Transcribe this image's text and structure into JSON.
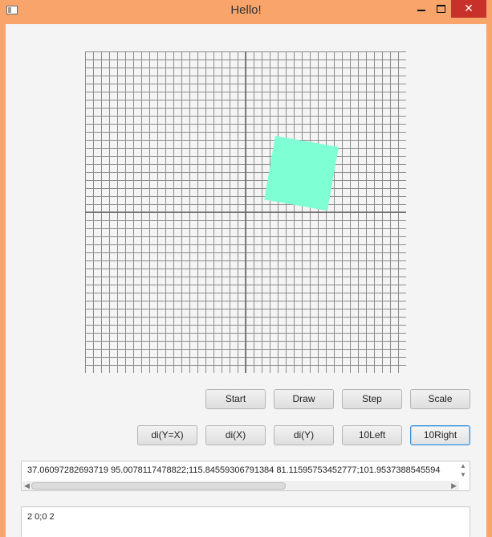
{
  "window": {
    "title": "Hello!",
    "minimize_icon": "minimize-icon",
    "maximize_icon": "maximize-icon",
    "close_icon": "close-icon",
    "close_glyph": "✕"
  },
  "canvas": {
    "grid_divisions_per_axis": 40,
    "axis_color": "#666666",
    "grid_color": "#8c8c8c",
    "shape": {
      "fill": "#7fffd4",
      "vertices": [
        [
          37.06,
          95.01
        ],
        [
          115.85,
          81.12
        ],
        [
          101.95,
          1.9
        ],
        [
          23.17,
          15.8
        ]
      ]
    }
  },
  "buttons_row1": [
    {
      "label": "Start",
      "name": "start-button"
    },
    {
      "label": "Draw",
      "name": "draw-button"
    },
    {
      "label": "Step",
      "name": "step-button"
    },
    {
      "label": "Scale",
      "name": "scale-button"
    }
  ],
  "buttons_row2": [
    {
      "label": "di(Y=X)",
      "name": "reflect-y-equals-x-button"
    },
    {
      "label": "di(X)",
      "name": "reflect-x-button"
    },
    {
      "label": "di(Y)",
      "name": "reflect-y-button"
    },
    {
      "label": "10Left",
      "name": "rotate-10-left-button"
    },
    {
      "label": "10Right",
      "name": "rotate-10-right-button"
    }
  ],
  "output": {
    "text": "37.06097282693719 95.0078117478822;115.84559306791384 81.11595753452777;101.9537388545594"
  },
  "input": {
    "text": "2 0;0 2"
  }
}
